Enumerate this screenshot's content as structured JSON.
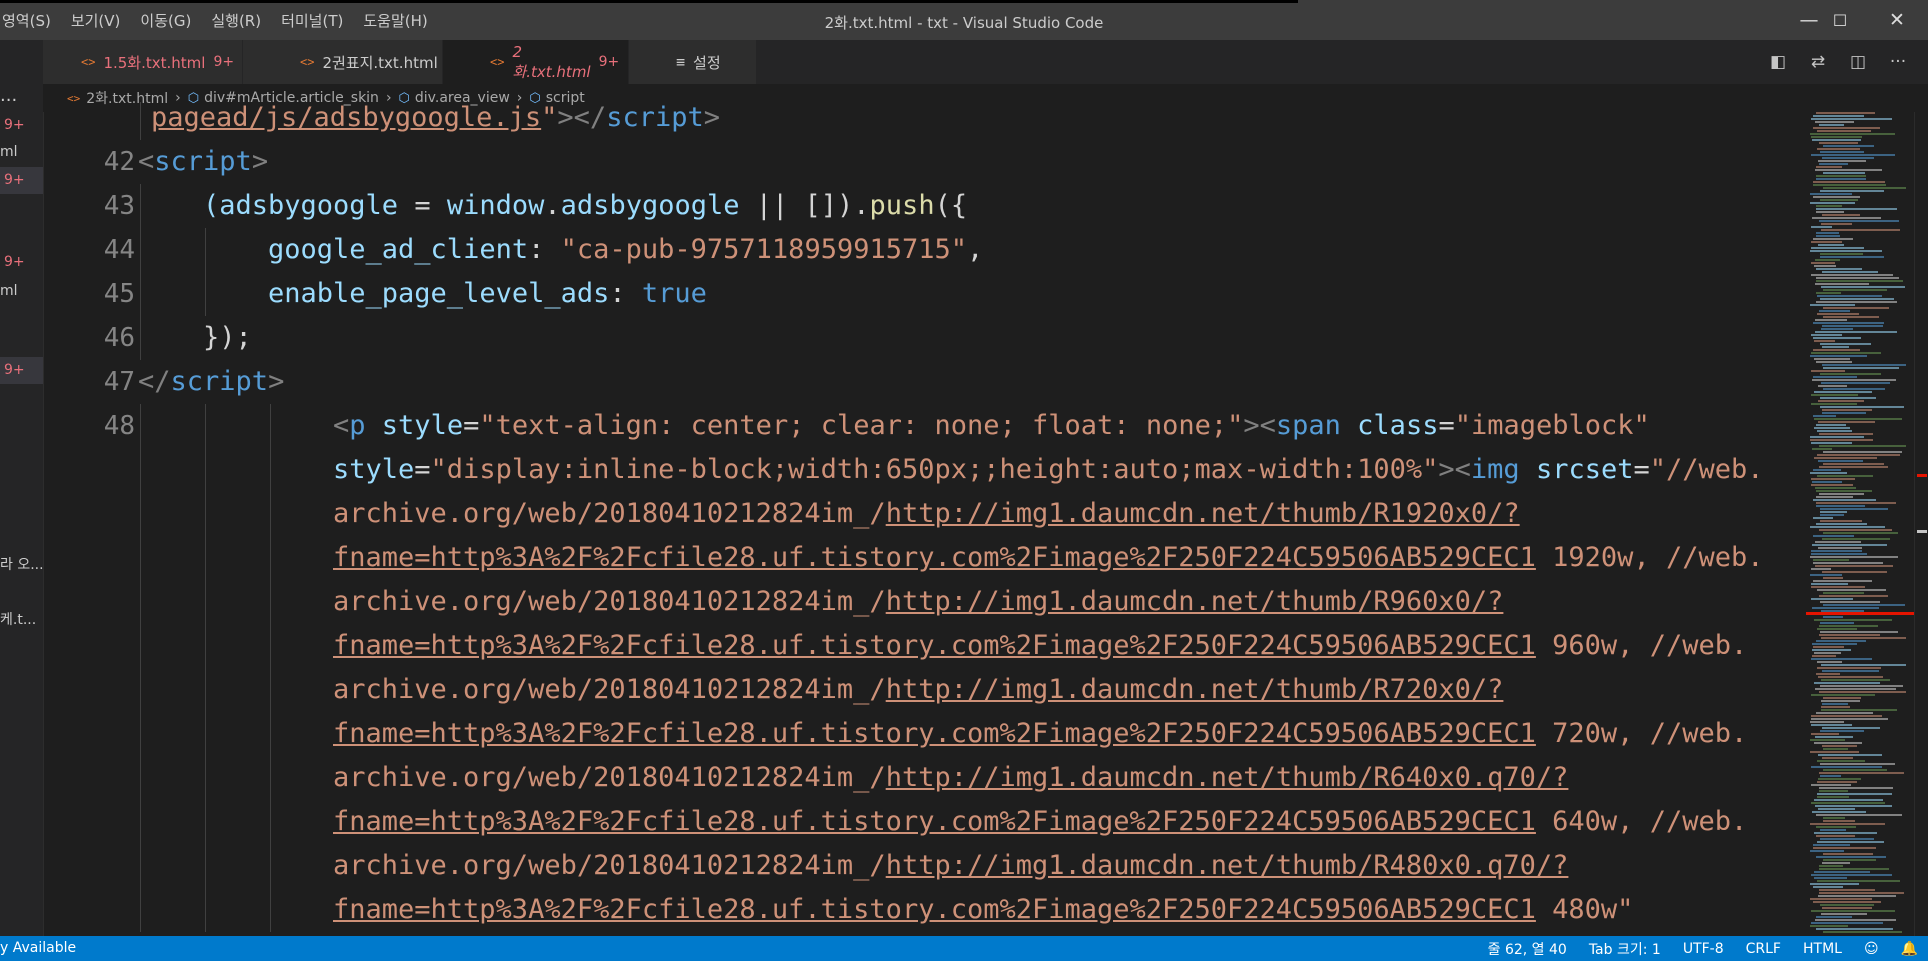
{
  "window": {
    "title": "2화.txt.html - txt - Visual Studio Code",
    "menu": [
      "영역(S)",
      "보기(V)",
      "이동(G)",
      "실행(R)",
      "터미널(T)",
      "도움말(H)"
    ],
    "controls": {
      "minimize": "—",
      "maximize": "☐",
      "close": "✕"
    }
  },
  "sidebar": {
    "ellipsis": "···",
    "items": [
      {
        "text": "9+",
        "badge": true,
        "selected": false
      },
      {
        "text": "ml",
        "badge": false,
        "selected": false
      },
      {
        "text": "9+",
        "badge": true,
        "selected": true
      },
      {
        "text": "9+",
        "badge": true,
        "selected": false
      },
      {
        "text": "ml",
        "badge": false,
        "selected": false
      },
      {
        "text": "9+",
        "badge": true,
        "selected": true
      },
      {
        "text": "라 오...",
        "badge": false,
        "selected": false
      },
      {
        "text": "케.t...",
        "badge": false,
        "selected": false
      }
    ]
  },
  "tabs": [
    {
      "icon": "<>",
      "label": "1.5화.txt.html",
      "count": "9+",
      "active": false
    },
    {
      "icon": "<>",
      "label": "2권표지.txt.html",
      "count": "",
      "active": false,
      "plain_label": true
    },
    {
      "icon": "<>",
      "label": "2화.txt.html",
      "count": "9+",
      "active": true,
      "close": "✕"
    },
    {
      "icon": "≡",
      "label": "설정",
      "count": "",
      "active": false,
      "plain": true
    }
  ],
  "editor_actions": [
    "open-preview-icon",
    "compare-changes-icon",
    "split-editor-icon",
    "more-actions-icon"
  ],
  "breadcrumb": {
    "file": "2화.txt.html",
    "segments": [
      "div#mArticle.article_skin",
      "div.area_view",
      "script"
    ]
  },
  "code": {
    "lines": [
      {
        "num": "",
        "indent": 1,
        "tokens": [
          {
            "t": "pagead/js/adsbygoogle.js",
            "c": "tk-u"
          },
          {
            "t": "\"",
            "c": "tk-str"
          },
          {
            "t": "></",
            "c": "tk-punct"
          },
          {
            "t": "script",
            "c": "tk-tag"
          },
          {
            "t": ">",
            "c": "tk-punct"
          }
        ]
      },
      {
        "num": "42",
        "indent": 0,
        "tokens": [
          {
            "t": "<",
            "c": "tk-punct"
          },
          {
            "t": "script",
            "c": "tk-tag"
          },
          {
            "t": ">",
            "c": "tk-punct"
          }
        ]
      },
      {
        "num": "43",
        "indent": 1,
        "tokens": [
          {
            "t": "(adsbygoogle",
            "c": "tk-attr"
          },
          {
            "t": " = ",
            "c": "tk-plain"
          },
          {
            "t": "window",
            "c": "tk-attr"
          },
          {
            "t": ".",
            "c": "tk-plain"
          },
          {
            "t": "adsbygoogle",
            "c": "tk-attr"
          },
          {
            "t": " || [])",
            "c": "tk-plain"
          },
          {
            "t": ".",
            "c": "tk-plain"
          },
          {
            "t": "push",
            "c": "tk-fn"
          },
          {
            "t": "({",
            "c": "tk-plain"
          }
        ]
      },
      {
        "num": "44",
        "indent": 2,
        "tokens": [
          {
            "t": "google_ad_client",
            "c": "tk-attr"
          },
          {
            "t": ": ",
            "c": "tk-plain"
          },
          {
            "t": "\"ca-pub-9757118959915715\"",
            "c": "tk-str"
          },
          {
            "t": ",",
            "c": "tk-plain"
          }
        ]
      },
      {
        "num": "45",
        "indent": 2,
        "tokens": [
          {
            "t": "enable_page_level_ads",
            "c": "tk-attr"
          },
          {
            "t": ": ",
            "c": "tk-plain"
          },
          {
            "t": "true",
            "c": "tk-kw"
          }
        ]
      },
      {
        "num": "46",
        "indent": 1,
        "tokens": [
          {
            "t": "});",
            "c": "tk-plain"
          }
        ]
      },
      {
        "num": "47",
        "indent": 0,
        "tokens": [
          {
            "t": "</",
            "c": "tk-punct"
          },
          {
            "t": "script",
            "c": "tk-tag"
          },
          {
            "t": ">",
            "c": "tk-punct"
          }
        ]
      },
      {
        "num": "48",
        "indent": 3,
        "tokens": [
          {
            "t": "<",
            "c": "tk-punct"
          },
          {
            "t": "p",
            "c": "tk-tag"
          },
          {
            "t": " ",
            "c": "tk-plain"
          },
          {
            "t": "style",
            "c": "tk-attr"
          },
          {
            "t": "=",
            "c": "tk-plain"
          },
          {
            "t": "\"text-align: center; clear: none; float: none;\"",
            "c": "tk-str"
          },
          {
            "t": "><",
            "c": "tk-punct"
          },
          {
            "t": "span",
            "c": "tk-tag"
          },
          {
            "t": " ",
            "c": "tk-plain"
          },
          {
            "t": "class",
            "c": "tk-attr"
          },
          {
            "t": "=",
            "c": "tk-plain"
          },
          {
            "t": "\"imageblock\"",
            "c": "tk-str"
          }
        ]
      },
      {
        "num": "",
        "indent": 3,
        "tokens": [
          {
            "t": "style",
            "c": "tk-attr"
          },
          {
            "t": "=",
            "c": "tk-plain"
          },
          {
            "t": "\"display:inline-block;width:650px;;height:auto;max-width:100%\"",
            "c": "tk-str"
          },
          {
            "t": "><",
            "c": "tk-punct"
          },
          {
            "t": "img",
            "c": "tk-tag"
          },
          {
            "t": " ",
            "c": "tk-plain"
          },
          {
            "t": "srcset",
            "c": "tk-attr"
          },
          {
            "t": "=",
            "c": "tk-plain"
          },
          {
            "t": "\"//web.",
            "c": "tk-str"
          }
        ]
      },
      {
        "num": "",
        "indent": 3,
        "tokens": [
          {
            "t": "archive.org/web/20180410212824im_/",
            "c": "tk-str"
          },
          {
            "t": "http://img1.daumcdn.net/thumb/R1920x0/?",
            "c": "tk-u"
          }
        ]
      },
      {
        "num": "",
        "indent": 3,
        "tokens": [
          {
            "t": "fname=http%3A%2F%2Fcfile28.uf.tistory.com%2Fimage%2F250F224C59506AB529CEC1",
            "c": "tk-u"
          },
          {
            "t": " 1920w, //web.",
            "c": "tk-str"
          }
        ]
      },
      {
        "num": "",
        "indent": 3,
        "tokens": [
          {
            "t": "archive.org/web/20180410212824im_/",
            "c": "tk-str"
          },
          {
            "t": "http://img1.daumcdn.net/thumb/R960x0/?",
            "c": "tk-u"
          }
        ]
      },
      {
        "num": "",
        "indent": 3,
        "tokens": [
          {
            "t": "fname=http%3A%2F%2Fcfile28.uf.tistory.com%2Fimage%2F250F224C59506AB529CEC1",
            "c": "tk-u"
          },
          {
            "t": " 960w, //web.",
            "c": "tk-str"
          }
        ]
      },
      {
        "num": "",
        "indent": 3,
        "tokens": [
          {
            "t": "archive.org/web/20180410212824im_/",
            "c": "tk-str"
          },
          {
            "t": "http://img1.daumcdn.net/thumb/R720x0/?",
            "c": "tk-u"
          }
        ]
      },
      {
        "num": "",
        "indent": 3,
        "tokens": [
          {
            "t": "fname=http%3A%2F%2Fcfile28.uf.tistory.com%2Fimage%2F250F224C59506AB529CEC1",
            "c": "tk-u"
          },
          {
            "t": " 720w, //web.",
            "c": "tk-str"
          }
        ]
      },
      {
        "num": "",
        "indent": 3,
        "tokens": [
          {
            "t": "archive.org/web/20180410212824im_/",
            "c": "tk-str"
          },
          {
            "t": "http://img1.daumcdn.net/thumb/R640x0.q70/?",
            "c": "tk-u"
          }
        ]
      },
      {
        "num": "",
        "indent": 3,
        "tokens": [
          {
            "t": "fname=http%3A%2F%2Fcfile28.uf.tistory.com%2Fimage%2F250F224C59506AB529CEC1",
            "c": "tk-u"
          },
          {
            "t": " 640w, //web.",
            "c": "tk-str"
          }
        ]
      },
      {
        "num": "",
        "indent": 3,
        "tokens": [
          {
            "t": "archive.org/web/20180410212824im_/",
            "c": "tk-str"
          },
          {
            "t": "http://img1.daumcdn.net/thumb/R480x0.q70/?",
            "c": "tk-u"
          }
        ]
      },
      {
        "num": "",
        "indent": 3,
        "tokens": [
          {
            "t": "fname=http%3A%2F%2Fcfile28.uf.tistory.com%2Fimage%2F250F224C59506AB529CEC1",
            "c": "tk-u"
          },
          {
            "t": " 480w\"",
            "c": "tk-str"
          }
        ]
      }
    ]
  },
  "statusbar": {
    "left": "y Available",
    "position": "줄 62, 열 40",
    "tab_size": "Tab 크기: 1",
    "encoding": "UTF-8",
    "eol": "CRLF",
    "language": "HTML",
    "icons": [
      "feedback-icon",
      "bell-icon"
    ]
  },
  "colors": {
    "statusbar": "#007acc",
    "editor_bg": "#1e1e1e",
    "titlebar": "#3c3c3c",
    "error": "#e8707b"
  }
}
